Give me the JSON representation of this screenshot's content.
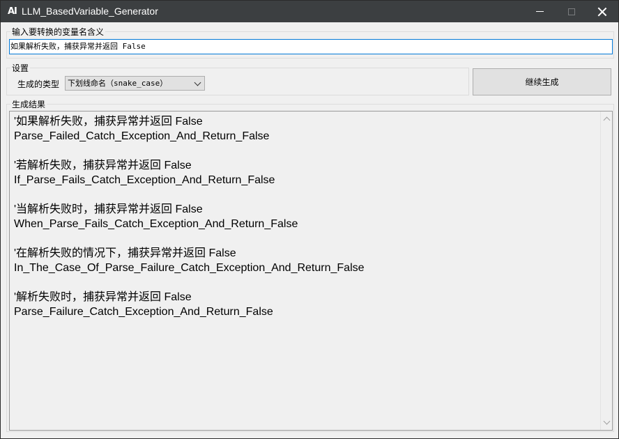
{
  "window": {
    "icon_text": "AI",
    "title": "LLM_BasedVariable_Generator"
  },
  "input_section": {
    "label": "输入要转换的变量名含义",
    "value": "如果解析失败，捕获异常并返回 False"
  },
  "settings": {
    "label": "设置",
    "type_label": "生成的类型",
    "type_selected": "下划线命名（snake_case）"
  },
  "generate_button": {
    "label": "继续生成"
  },
  "results": {
    "label": "生成结果",
    "entries": [
      {
        "source": "'如果解析失败，捕获异常并返回 False",
        "variable": "Parse_Failed_Catch_Exception_And_Return_False"
      },
      {
        "source": "'若解析失败，捕获异常并返回 False",
        "variable": "If_Parse_Fails_Catch_Exception_And_Return_False"
      },
      {
        "source": "'当解析失败时，捕获异常并返回 False",
        "variable": "When_Parse_Fails_Catch_Exception_And_Return_False"
      },
      {
        "source": "'在解析失败的情况下，捕获异常并返回 False",
        "variable": "In_The_Case_Of_Parse_Failure_Catch_Exception_And_Return_False"
      },
      {
        "source": "'解析失败时，捕获异常并返回 False",
        "variable": "Parse_Failure_Catch_Exception_And_Return_False"
      }
    ]
  },
  "colors": {
    "titlebar": "#3c3f41",
    "window_bg": "#f0f0f0",
    "input_focus_border": "#0078d7",
    "button_bg": "#e1e1e1"
  },
  "icons": [
    "minimize-icon",
    "maximize-icon",
    "close-icon",
    "chevron-down-icon",
    "scroll-up-icon",
    "scroll-down-icon"
  ]
}
